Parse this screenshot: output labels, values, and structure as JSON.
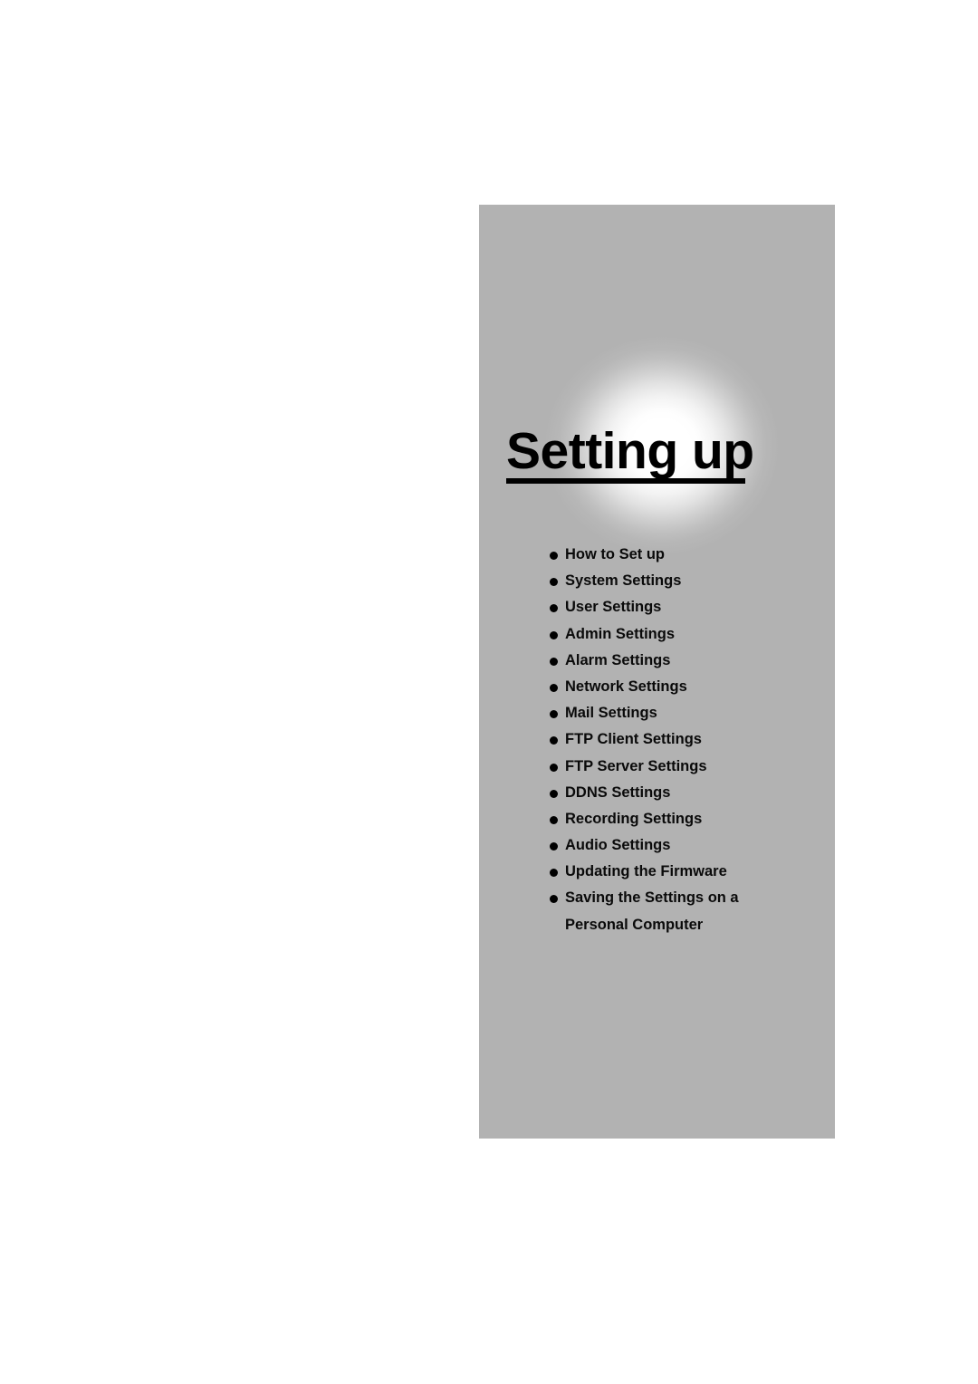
{
  "page": {
    "background_color": "#ffffff",
    "panel_color": "#b2b2b2",
    "text_color": "#000000"
  },
  "chapter": {
    "title": "Setting up",
    "glow_icon": "radial-glow",
    "items": [
      {
        "label": "How to Set up"
      },
      {
        "label": "System Settings"
      },
      {
        "label": "User Settings"
      },
      {
        "label": "Admin Settings"
      },
      {
        "label": "Alarm Settings"
      },
      {
        "label": "Network Settings"
      },
      {
        "label": "Mail Settings"
      },
      {
        "label": "FTP Client Settings"
      },
      {
        "label": "FTP Server Settings"
      },
      {
        "label": "DDNS Settings"
      },
      {
        "label": "Recording Settings"
      },
      {
        "label": "Audio Settings"
      },
      {
        "label": "Updating the Firmware"
      },
      {
        "label": "Saving the Settings on a",
        "continuation": "Personal Computer"
      }
    ]
  }
}
